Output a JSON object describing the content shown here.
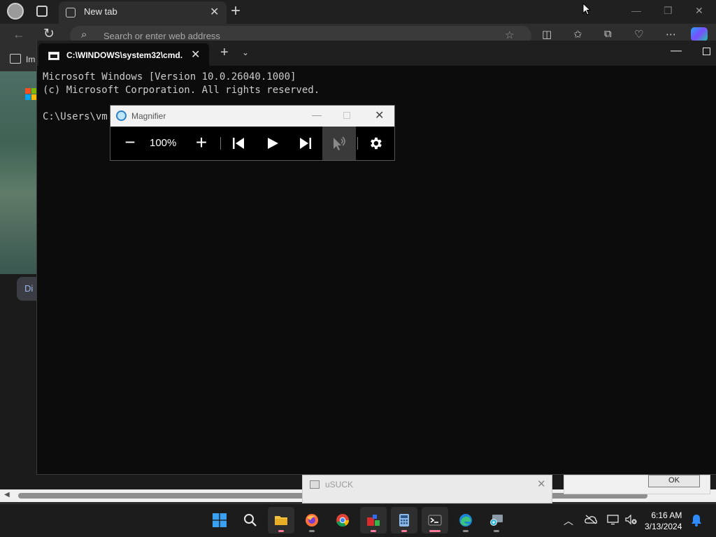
{
  "browser": {
    "tab_title": "New tab",
    "address_placeholder": "Search or enter web address",
    "favorites_label": "Im",
    "discover_label": "Di"
  },
  "cmd": {
    "tab_title": "C:\\WINDOWS\\system32\\cmd.",
    "lines": [
      "Microsoft Windows [Version 10.0.26040.1000]",
      "(c) Microsoft Corporation. All rights reserved.",
      "",
      "C:\\Users\\vm"
    ]
  },
  "magnifier": {
    "title": "Magnifier",
    "zoom_level": "100%",
    "minus_label": "−",
    "plus_label": "+"
  },
  "dialog": {
    "title": "uSUCK",
    "ok_label": "OK"
  },
  "taskbar": {
    "apps": [
      "start",
      "search",
      "file-explorer",
      "firefox",
      "chrome",
      "app-red",
      "calculator",
      "terminal",
      "edge",
      "magnifier"
    ],
    "time": "6:16 AM",
    "date": "3/13/2024"
  },
  "colors": {
    "accent": "#2f8cff",
    "active_indicator": "#ff7b9c",
    "terminal_bg": "#0c0c0c"
  }
}
